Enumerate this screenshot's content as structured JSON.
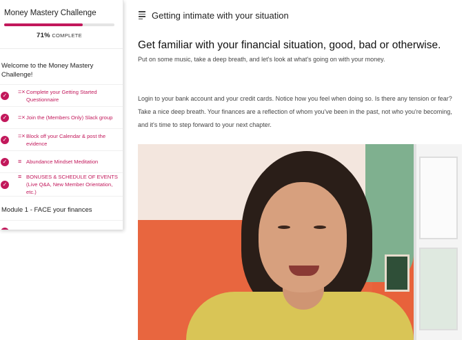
{
  "sidebar": {
    "course_title": "Money Mastery Challenge",
    "progress_percent": 71,
    "progress_pct_label": "71%",
    "progress_complete_label": "COMPLETE",
    "sections": [
      {
        "title": "Welcome to the Money Mastery Challenge!",
        "lessons": [
          {
            "type": "assignment-icon",
            "label": "Complete your Getting Started Questionnaire",
            "completed": true
          },
          {
            "type": "assignment-icon",
            "label": "Join the (Members Only) Slack group",
            "completed": true
          },
          {
            "type": "assignment-icon",
            "label": "Block off your Calendar & post the evidence",
            "completed": true
          },
          {
            "type": "text-lines-icon",
            "label": "Abundance Mindset Meditation",
            "completed": true
          },
          {
            "type": "text-lines-icon",
            "label": "BONUSES & SCHEDULE OF EVENTS (Live Q&A, New Member Orientation, etc.)",
            "completed": true
          }
        ]
      },
      {
        "title": "Module 1 - FACE your finances",
        "lessons": []
      }
    ]
  },
  "main": {
    "lesson_title": "Getting intimate with your situation",
    "heading": "Get familiar with your financial situation, good, bad or otherwise.",
    "subtext": "Put on some music, take a deep breath, and let's look at what's going on with your money.",
    "body": "Login to your bank account and your credit cards. Notice how you feel when doing so. Is there any tension or fear? Take a nice deep breath. Your finances are a reflection of whom you've been in the past, not who you're becoming, and it's time to step forward to your next chapter."
  },
  "colors": {
    "accent": "#c2185b",
    "progress_track": "#e4e4e4",
    "video_wall_orange": "#e8663f",
    "video_wall_green": "#7fb08f"
  },
  "icons": {
    "menu": "hamburger-menu-icon",
    "check": "check-circle-icon"
  }
}
